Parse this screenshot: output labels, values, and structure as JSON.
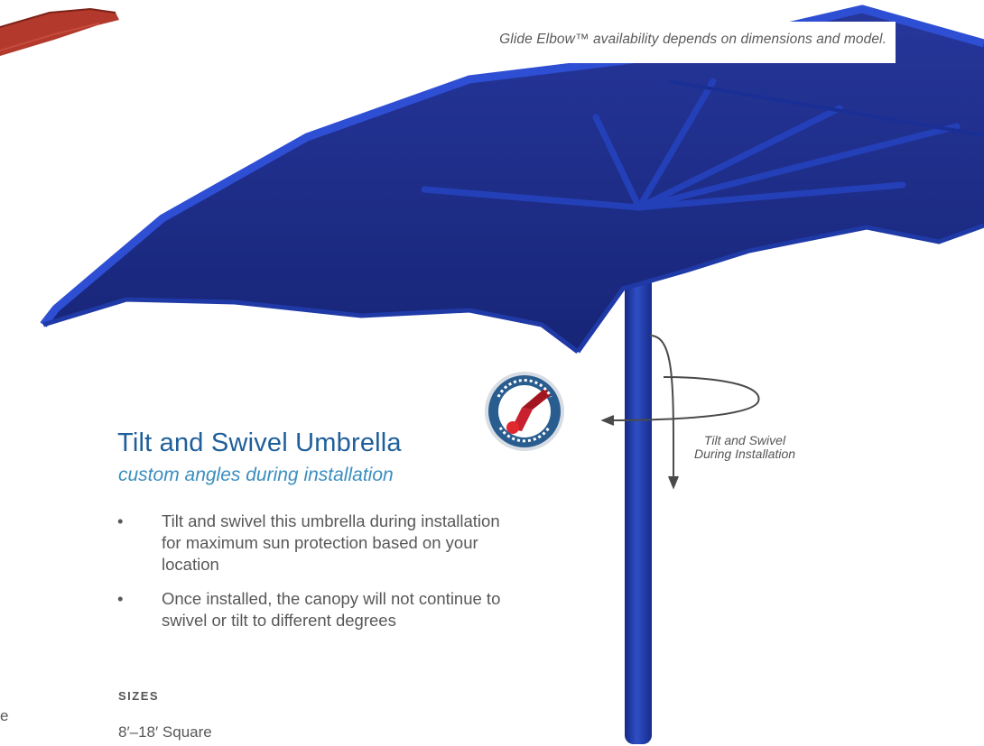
{
  "note": {
    "text": "Glide Elbow™ availability depends on dimensions and model."
  },
  "product": {
    "title": "Tilt and Swivel Umbrella",
    "subtitle": "custom angles during installation",
    "bullet_marker": "•",
    "features": [
      "Tilt and swivel this umbrella during installation for maximum sun protection based on your location",
      "Once installed, the canopy will not continue to swivel or tilt to different degrees"
    ]
  },
  "sizes": {
    "heading": "SIZES",
    "value": "8′–18′ Square"
  },
  "edge_fragment": "e",
  "illustration": {
    "rotation_label_line1": "Tilt and Swivel",
    "rotation_label_line2": "During Installation",
    "canopy_color": "#1c2c8a",
    "pole_color": "#1e3aa8",
    "badge_red": "#c8202e"
  }
}
